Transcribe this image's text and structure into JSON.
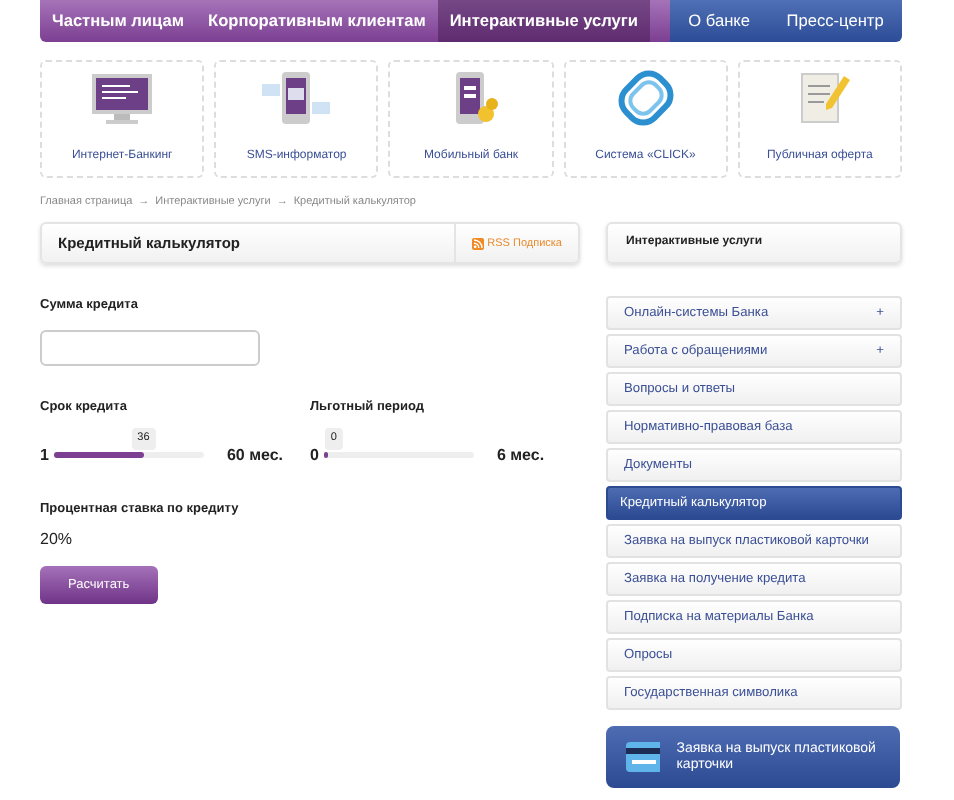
{
  "top_nav": {
    "primary": [
      {
        "label": "Частным лицам",
        "selected": false
      },
      {
        "label": "Корпоративным клиентам",
        "selected": false
      },
      {
        "label": "Интерактивные услуги",
        "selected": true
      }
    ],
    "secondary": [
      {
        "label": "О банке",
        "selected": false
      },
      {
        "label": "Пресс-центр",
        "selected": false
      }
    ]
  },
  "service_tiles": [
    {
      "label": "Интернет-Банкинг",
      "kind": "monitor"
    },
    {
      "label": "SMS-информатор",
      "kind": "sms"
    },
    {
      "label": "Мобильный банк",
      "kind": "mobile"
    },
    {
      "label": "Система «CLICK»",
      "kind": "click"
    },
    {
      "label": "Публичная оферта",
      "kind": "document"
    }
  ],
  "breadcrumbs": [
    "Главная страница",
    "→",
    "Интерактивные услуги",
    "→",
    "Кредитный калькулятор"
  ],
  "calculator": {
    "title": "Кредитный калькулятор",
    "rss_link": "RSS Подписка",
    "amount_label": "Сумма кредита",
    "sliders": [
      {
        "label": "Срок кредита",
        "min": "1",
        "max": "60 мес.",
        "value": "36",
        "level": 0.59
      },
      {
        "label": "Льготный период",
        "min": "0",
        "max": "6 мес.",
        "value": "0",
        "level": 0
      }
    ],
    "rate_label": "Процентная ставка по кредиту",
    "rate_value": "20%",
    "button": "Расчитать"
  },
  "sidebar": {
    "title": "Интерактивные услуги",
    "items": [
      {
        "label": "Онлайн-системы Банка",
        "toggle": "+",
        "selected": false
      },
      {
        "label": "Работа с обращениями",
        "toggle": "+",
        "selected": false
      },
      {
        "label": "Вопросы и ответы",
        "selected": false
      },
      {
        "label": "Нормативно-правовая база",
        "selected": false
      },
      {
        "label": "Документы",
        "selected": false
      },
      {
        "label": "Кредитный калькулятор",
        "selected": true
      },
      {
        "label": "Заявка на выпуск пластиковой карточки",
        "selected": false
      },
      {
        "label": "Заявка на получение кредита",
        "selected": false
      },
      {
        "label": "Подписка на материалы Банка",
        "selected": false
      },
      {
        "label": "Опросы",
        "selected": false
      },
      {
        "label": "Государственная символика",
        "selected": false
      }
    ],
    "banner": "Заявка на выпуск пластиковой карточки"
  }
}
